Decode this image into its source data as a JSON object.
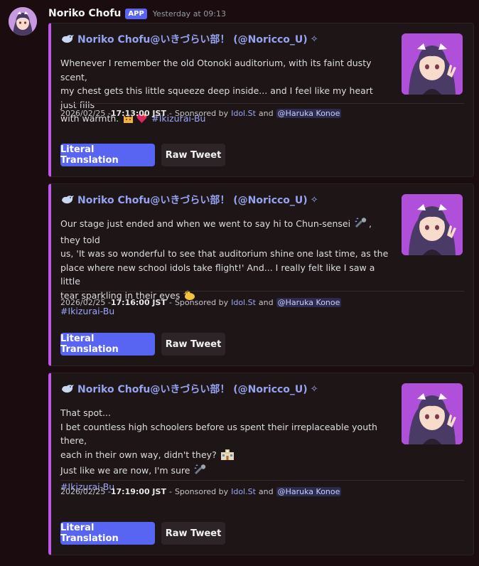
{
  "message": {
    "author": "Noriko Chofu",
    "badge": "APP",
    "timestamp": "Yesterday at 09:13"
  },
  "embeds": [
    {
      "author": "Noriko Chofu@いきづらい部！ (@Noricco_U)",
      "description_lines": [
        "Whenever I remember the old Otonoki auditorium, with its faint dusty scent,",
        "my chest gets this little squeeze deep inside... and I feel like my heart just fills",
        "with warmth."
      ],
      "hashtag": "#Ikizurai-Bu",
      "footer": {
        "date": "2026/02/25 - ",
        "time": "17:13:00 JST",
        "sponsored_prefix": "Sponsored by",
        "sponsor_link": "Idol.St",
        "and": "and",
        "mention": "@Haruka Konoe"
      },
      "buttons": {
        "primary": "Literal Translation",
        "secondary": "Raw Tweet"
      }
    },
    {
      "author": "Noriko Chofu@いきづらい部！ (@Noricco_U)",
      "description_lines": [
        "Our stage just ended and when we went to say hi to Chun-sensei",
        ", they told",
        "us, 'It was so wonderful to see that auditorium shine one last time, as the",
        "place where new school idols take flight!' And... I really felt like I saw a little",
        "tear sparkling in their eyes"
      ],
      "hashtag": "#Ikizurai-Bu",
      "footer": {
        "date": "2026/02/25 - ",
        "time": "17:16:00 JST",
        "sponsored_prefix": "Sponsored by",
        "sponsor_link": "Idol.St",
        "and": "and",
        "mention": "@Haruka Konoe"
      },
      "buttons": {
        "primary": "Literal Translation",
        "secondary": "Raw Tweet"
      }
    },
    {
      "author": "Noriko Chofu@いきづらい部！ (@Noricco_U)",
      "description_lines": [
        "That spot...",
        "I bet countless high schoolers before us spent their irreplaceable youth there,",
        "each in their own way, didn't they?",
        "Just like we are now, I'm sure"
      ],
      "hashtag": "#Ikizurai-Bu",
      "footer": {
        "date": "2026/02/25 - ",
        "time": "17:19:00 JST",
        "sponsored_prefix": "Sponsored by",
        "sponsor_link": "Idol.St",
        "and": "and",
        "mention": "@Haruka Konoe"
      },
      "buttons": {
        "primary": "Literal Translation",
        "secondary": "Raw Tweet"
      }
    }
  ],
  "colors": {
    "accent_bar": "#c157e8",
    "button_primary": "#5865f2",
    "link": "#9aa7f6"
  }
}
